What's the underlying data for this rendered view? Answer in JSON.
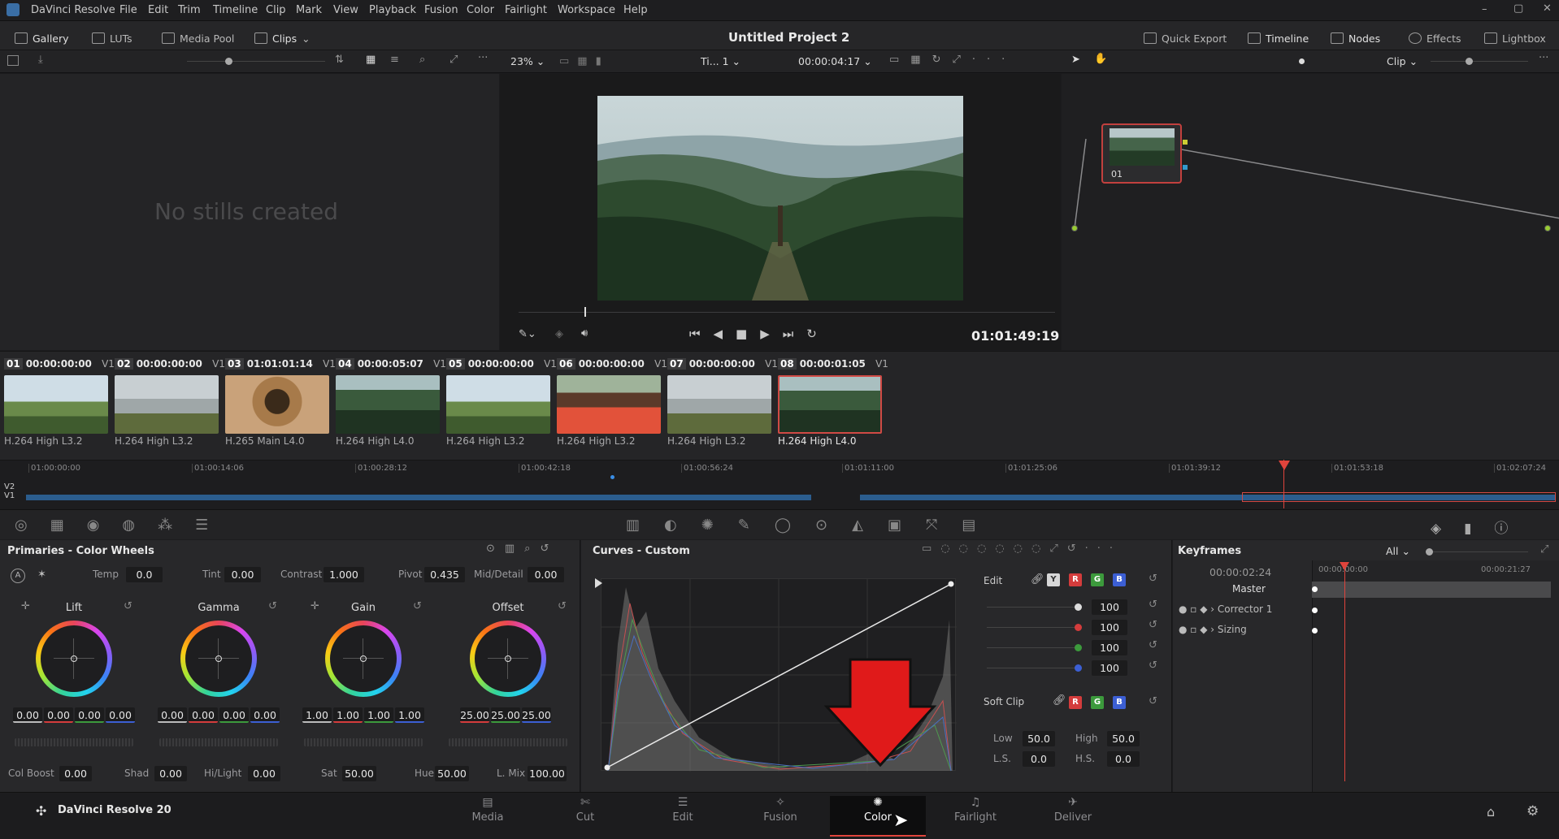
{
  "menubar": {
    "app": "DaVinci Resolve",
    "items": [
      "File",
      "Edit",
      "Trim",
      "Timeline",
      "Clip",
      "Mark",
      "View",
      "Playback",
      "Fusion",
      "Color",
      "Fairlight",
      "Workspace",
      "Help"
    ]
  },
  "appbar": {
    "project_title": "Untitled Project 2",
    "left": [
      "Gallery",
      "LUTs",
      "Media Pool",
      "Clips"
    ],
    "right": [
      "Quick Export",
      "Timeline",
      "Nodes",
      "Effects",
      "Lightbox"
    ]
  },
  "viewer": {
    "zoom": "23%",
    "timeline_name": "Ti... 1",
    "timecode": "00:00:04:17",
    "playback_tc": "01:01:49:19",
    "clip_mode": "Clip"
  },
  "gallery": {
    "empty_text": "No stills created"
  },
  "nodes": {
    "node_label": "01"
  },
  "clips": [
    {
      "num": "01",
      "tc": "00:00:00:00",
      "track": "V1",
      "codec": "H.264 High L3.2"
    },
    {
      "num": "02",
      "tc": "00:00:00:00",
      "track": "V1",
      "codec": "H.264 High L3.2"
    },
    {
      "num": "03",
      "tc": "01:01:01:14",
      "track": "V1",
      "codec": "H.265 Main L4.0"
    },
    {
      "num": "04",
      "tc": "00:00:05:07",
      "track": "V1",
      "codec": "H.264 High L4.0"
    },
    {
      "num": "05",
      "tc": "00:00:00:00",
      "track": "V1",
      "codec": "H.264 High L3.2"
    },
    {
      "num": "06",
      "tc": "00:00:00:00",
      "track": "V1",
      "codec": "H.264 High L3.2"
    },
    {
      "num": "07",
      "tc": "00:00:00:00",
      "track": "V1",
      "codec": "H.264 High L3.2"
    },
    {
      "num": "08",
      "tc": "00:00:01:05",
      "track": "V1",
      "codec": "H.264 High L4.0"
    }
  ],
  "ruler": [
    "01:00:00:00",
    "01:00:14:06",
    "01:00:28:12",
    "01:00:42:18",
    "01:00:56:24",
    "01:01:11:00",
    "01:01:25:06",
    "01:01:39:12",
    "01:01:53:18",
    "01:02:07:24"
  ],
  "tracks": [
    "V2",
    "V1"
  ],
  "primaries": {
    "title": "Primaries - Color Wheels",
    "temp_label": "Temp",
    "temp": "0.0",
    "tint_label": "Tint",
    "tint": "0.00",
    "contrast_label": "Contrast",
    "contrast": "1.000",
    "pivot_label": "Pivot",
    "pivot": "0.435",
    "middetail_label": "Mid/Detail",
    "middetail": "0.00",
    "wheels": [
      {
        "name": "Lift",
        "vals": [
          "0.00",
          "0.00",
          "0.00",
          "0.00"
        ]
      },
      {
        "name": "Gamma",
        "vals": [
          "0.00",
          "0.00",
          "0.00",
          "0.00"
        ]
      },
      {
        "name": "Gain",
        "vals": [
          "1.00",
          "1.00",
          "1.00",
          "1.00"
        ]
      },
      {
        "name": "Offset",
        "vals": [
          "25.00",
          "25.00",
          "25.00"
        ]
      }
    ],
    "bottom": {
      "colboost_label": "Col Boost",
      "colboost": "0.00",
      "shad_label": "Shad",
      "shad": "0.00",
      "hilight_label": "Hi/Light",
      "hilight": "0.00",
      "sat_label": "Sat",
      "sat": "50.00",
      "hue_label": "Hue",
      "hue": "50.00",
      "lmix_label": "L. Mix",
      "lmix": "100.00"
    }
  },
  "curves": {
    "title": "Curves - Custom",
    "edit_label": "Edit",
    "channel_vals": [
      "100",
      "100",
      "100",
      "100"
    ],
    "softclip_label": "Soft Clip",
    "low_label": "Low",
    "low": "50.0",
    "high_label": "High",
    "high": "50.0",
    "ls_label": "L.S.",
    "ls": "0.0",
    "hs_label": "H.S.",
    "hs": "0.0",
    "channel_buttons": [
      "Y",
      "R",
      "G",
      "B"
    ]
  },
  "keyframes": {
    "title": "Keyframes",
    "filter": "All",
    "tc": "00:00:02:24",
    "ruler": [
      "00:00:00:00",
      "00:00:21:27"
    ],
    "rows": [
      "Master",
      "Corrector 1",
      "Sizing"
    ]
  },
  "pages": {
    "brand": "DaVinci Resolve 20",
    "tabs": [
      "Media",
      "Cut",
      "Edit",
      "Fusion",
      "Color",
      "Fairlight",
      "Deliver"
    ],
    "active": "Color"
  },
  "colors": {
    "accent": "#e0443c",
    "active_clip_border": "#d04a45",
    "timeline_blue": "#2a5a8c"
  }
}
